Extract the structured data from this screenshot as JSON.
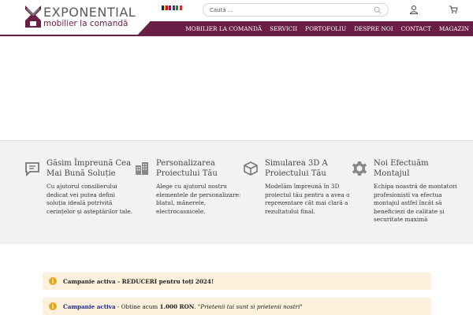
{
  "brand": {
    "title": "EXPONENTIAL",
    "subtitle": "mobilier la comandă",
    "colors": {
      "primary": "#6b1f47",
      "notice_bg": "#fbf1dc",
      "accent_blue": "#1d2b8f"
    }
  },
  "languages": [
    "ro",
    "en",
    "it"
  ],
  "search": {
    "placeholder": "Caută ..."
  },
  "icons": {
    "search": "search-icon",
    "account": "user-icon",
    "cart": "cart-icon"
  },
  "menu": [
    {
      "label": "MOBILIER LA COMANDĂ"
    },
    {
      "label": "SERVICII"
    },
    {
      "label": "PORTOFOLIU"
    },
    {
      "label": "DESPRE NOI"
    },
    {
      "label": "CONTACT"
    },
    {
      "label": "MAGAZIN"
    }
  ],
  "features": [
    {
      "icon": "chat-icon",
      "title": "Găsim Împreună Cea Mai Bună Soluție",
      "text": "Cu ajutorul consilierului dedicat vei putea defini soluția ideală potrivită cerințelor și așteptărilor tale."
    },
    {
      "icon": "building-icon",
      "title": "Personalizarea Proiectului Tău",
      "text": "Alege cu ajutorul nostru elementele de personalizare: blatul, mânerele, electrocasnicele."
    },
    {
      "icon": "cube-icon",
      "title": "Simularea 3D A Proiectului Tău",
      "text": "Modelăm împreună în 3D proiectul tău pentru a avea o reprezentare cât mai clară a rezultatului final."
    },
    {
      "icon": "gear-icon",
      "title": "Noi Efectuăm Montajul",
      "text": "Echipa noastră de montatori profesioniști va efectua montajul astfel încât să beneficiezi de calitate și securitate maximă"
    }
  ],
  "notices": [
    {
      "strong": "Campanie activa - REDUCERI pentru toți 2024!"
    },
    {
      "strong": "Campanie activa",
      "middle": " - Obtine acum ",
      "amount": "1.000 RON",
      "sep": ". ",
      "quote": "\"Prietenii tai sunt si prietenii nostri\""
    }
  ]
}
